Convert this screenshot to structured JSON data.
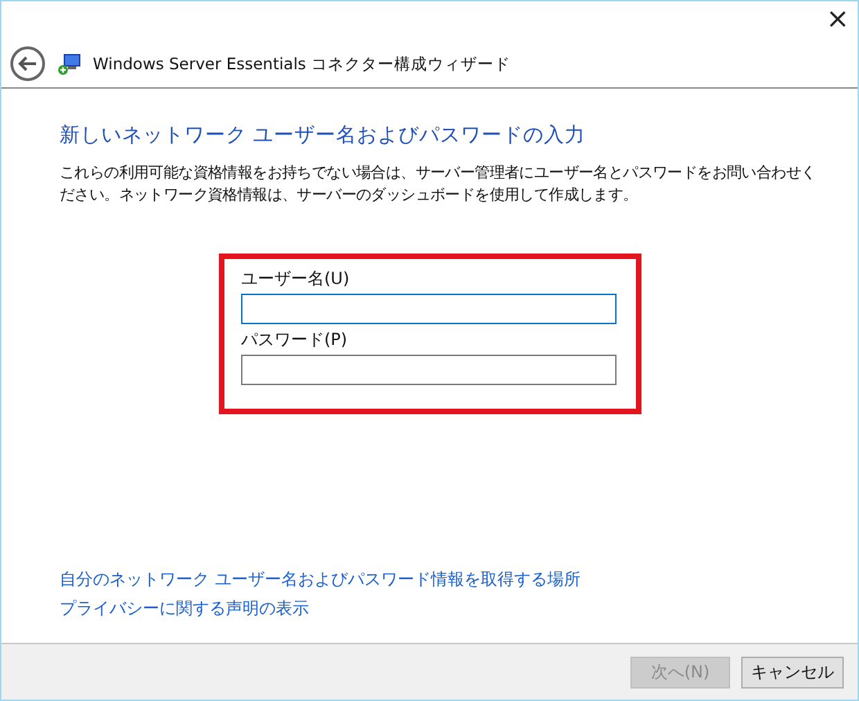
{
  "window": {
    "title": "Windows Server Essentials コネクター構成ウィザード",
    "close": "×"
  },
  "heading": "新しいネットワーク ユーザー名およびパスワードの入力",
  "description": "これらの利用可能な資格情報をお持ちでない場合は、サーバー管理者にユーザー名とパスワードをお問い合わせください。ネットワーク資格情報は、サーバーのダッシュボードを使用して作成します。",
  "highlight": true,
  "fields": [
    {
      "label": "ユーザー名(U)",
      "focused": true
    },
    {
      "label": "パスワード(P)",
      "focused": false
    }
  ],
  "links": [
    "自分のネットワーク ユーザー名およびパスワード情報を取得する場所",
    "プライバシーに関する声明の表示"
  ],
  "buttons": [
    {
      "label": "次へ(N)",
      "disabled": true
    },
    {
      "label": "キャンセル",
      "disabled": false
    }
  ]
}
